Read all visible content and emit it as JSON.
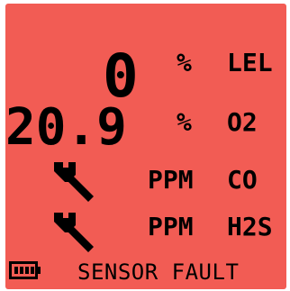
{
  "display": {
    "rows": [
      {
        "reading": "0",
        "unit": "%",
        "gas": "LEL",
        "fault_icon": null
      },
      {
        "reading": "20.9",
        "unit": "%",
        "gas": "O2",
        "fault_icon": null
      },
      {
        "reading": "",
        "unit": "PPM",
        "gas": "CO",
        "fault_icon": "wrench-icon"
      },
      {
        "reading": "",
        "unit": "PPM",
        "gas": "H2S",
        "fault_icon": "wrench-icon"
      }
    ],
    "status_text": "SENSOR FAULT",
    "battery_icon": "battery-icon",
    "colors": {
      "screen_background": "#f25c54",
      "foreground": "#000000"
    }
  }
}
